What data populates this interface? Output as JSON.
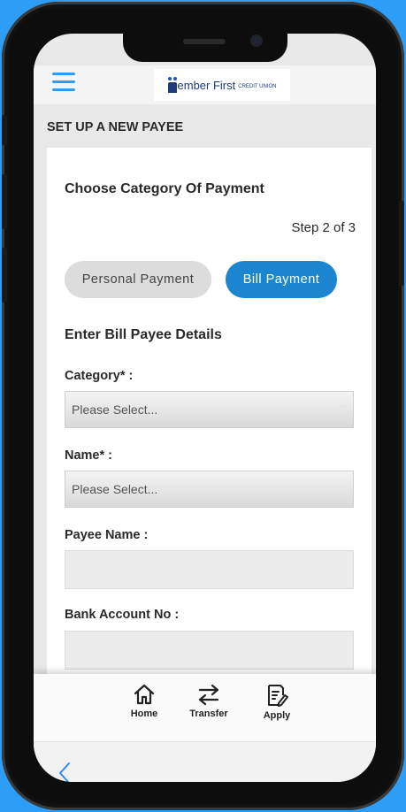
{
  "header": {
    "logo_text": "ember First",
    "logo_sub": "CREDIT UNION"
  },
  "page": {
    "title": "SET UP A NEW PAYEE"
  },
  "form": {
    "heading": "Choose Category Of Payment",
    "step": "Step 2 of 3",
    "payment_types": {
      "personal": "Personal Payment",
      "bill": "Bill Payment",
      "selected": "Bill Payment"
    },
    "details_heading": "Enter Bill Payee Details",
    "category": {
      "label": "Category* :",
      "value": "Please Select..."
    },
    "name": {
      "label": "Name* :",
      "value": "Please Select..."
    },
    "payee_name": {
      "label": "Payee Name :",
      "value": ""
    },
    "bank_account": {
      "label": "Bank Account No :",
      "value": ""
    }
  },
  "tabbar": {
    "home": "Home",
    "transfer": "Transfer",
    "apply": "Apply"
  },
  "colors": {
    "accent": "#1b86cf",
    "background": "#2e9df5",
    "brand": "#1e3a78"
  },
  "icons": [
    "menu-icon",
    "home-icon",
    "transfer-icon",
    "apply-icon",
    "back-chevron-icon"
  ]
}
